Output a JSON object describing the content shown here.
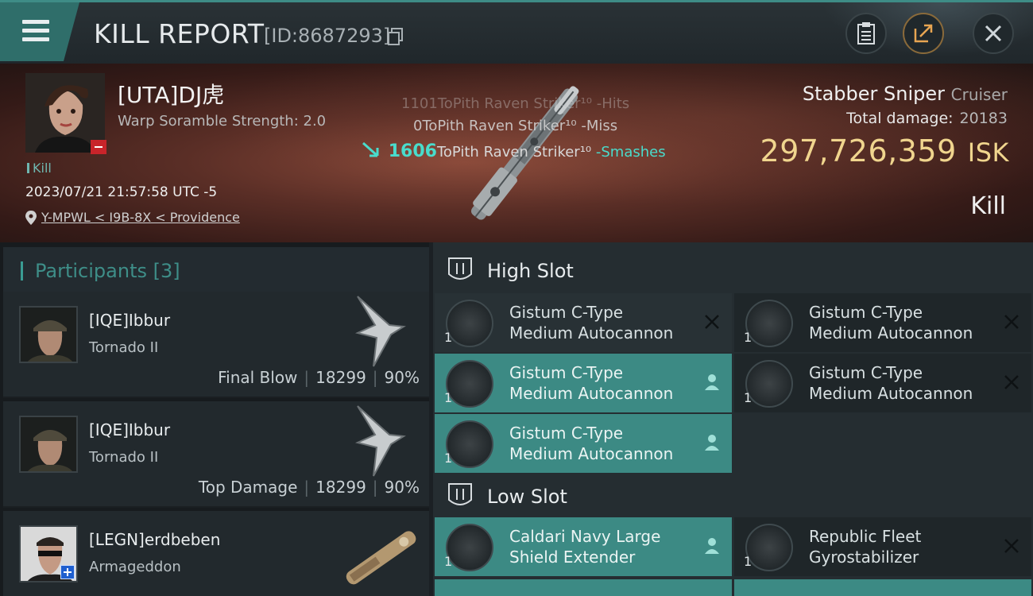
{
  "header": {
    "title": "KILL REPORT",
    "kill_id": "[ID:8687293]",
    "icons": [
      "menu-icon",
      "copy-icon",
      "clipboard-icon",
      "share-icon",
      "close-icon"
    ]
  },
  "victim": {
    "name": "[UTA]DJ虎",
    "warp_scramble": "Warp Soramble Strength: 2.0",
    "kill_tag": "Kill",
    "timestamp": "2023/07/21 21:57:58 UTC -5",
    "location": "Y-MPWL < I9B-8X < Providence"
  },
  "combat_log": [
    {
      "damage": "1101",
      "text": "ToPith Raven Striker¹⁰ -Hits"
    },
    {
      "damage": "0",
      "text": "ToPith Raven Striker¹⁰ -Miss"
    },
    {
      "damage": "1606",
      "text": "ToPith Raven Striker¹⁰",
      "result": "-Smashes"
    }
  ],
  "ship": {
    "name": "Stabber Sniper",
    "class": "Cruiser",
    "total_damage_label": "Total damage:",
    "total_damage": "20183",
    "isk_value": "297,726,359",
    "isk_unit": "ISK",
    "result": "Kill"
  },
  "participants": {
    "label": "Participants",
    "count": "[3]",
    "rows": [
      {
        "name": "[IQE]Ibbur",
        "ship": "Tornado II",
        "role": "Final Blow",
        "damage": "18299",
        "percent": "90%"
      },
      {
        "name": "[IQE]Ibbur",
        "ship": "Tornado II",
        "role": "Top Damage",
        "damage": "18299",
        "percent": "90%"
      },
      {
        "name": "[LEGN]erdbeben",
        "ship": "Armageddon"
      }
    ]
  },
  "slots": {
    "high_label": "High Slot",
    "low_label": "Low Slot",
    "high": [
      {
        "qty": "1",
        "line1": "Gistum C-Type",
        "line2": "Medium Autocannon",
        "state": "destroyed"
      },
      {
        "qty": "1",
        "line1": "Gistum C-Type",
        "line2": "Medium Autocannon",
        "state": "destroyed"
      },
      {
        "qty": "1",
        "line1": "Gistum C-Type",
        "line2": "Medium Autocannon",
        "state": "dropped"
      },
      {
        "qty": "1",
        "line1": "Gistum C-Type",
        "line2": "Medium Autocannon",
        "state": "destroyed"
      },
      {
        "qty": "1",
        "line1": "Gistum C-Type",
        "line2": "Medium Autocannon",
        "state": "dropped"
      }
    ],
    "low": [
      {
        "qty": "1",
        "line1": "Caldari Navy Large",
        "line2": "Shield Extender",
        "state": "dropped"
      },
      {
        "qty": "1",
        "line1": "Republic Fleet",
        "line2": "Gyrostabilizer",
        "state": "destroyed"
      }
    ]
  },
  "colors": {
    "accent": "#3c8a84",
    "isk_gold": "#f0d58e",
    "smash_cyan": "#49dccc",
    "background": "#1b2024"
  }
}
